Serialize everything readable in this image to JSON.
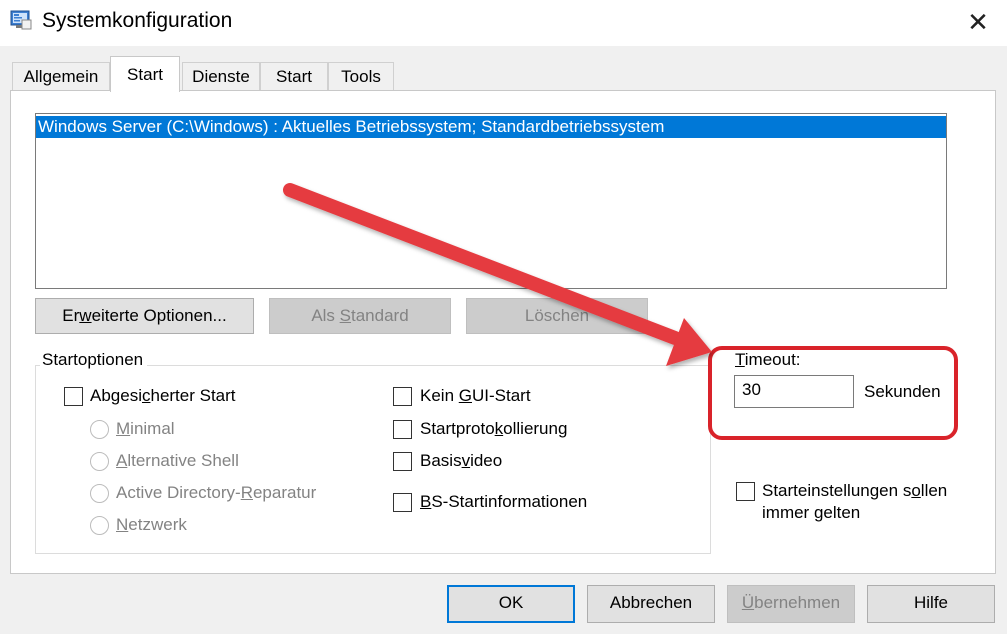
{
  "window": {
    "title": "Systemkonfiguration",
    "close_glyph": "✕"
  },
  "tabs": [
    {
      "label": "Allgemein"
    },
    {
      "label": "Start"
    },
    {
      "label": "Dienste"
    },
    {
      "label": "Start"
    },
    {
      "label": "Tools"
    }
  ],
  "boot_list": {
    "entries": [
      "Windows Server (C:\\Windows) : Aktuelles Betriebssystem; Standardbetriebssystem"
    ]
  },
  "boot_buttons": {
    "advanced": {
      "pre": "Er",
      "key": "w",
      "post": "eiterte Optionen..."
    },
    "set_default": {
      "pre": "Als ",
      "key": "S",
      "post": "tandard"
    },
    "delete": {
      "label": "Löschen"
    }
  },
  "startoptions": {
    "label": "Startoptionen",
    "safe_boot": {
      "pre": "Abgesi",
      "key": "c",
      "post": "herter Start"
    },
    "radios": {
      "minimal": {
        "key": "M",
        "post": "inimal"
      },
      "alt_shell": {
        "key": "A",
        "post": "lternative Shell"
      },
      "ad_repair": {
        "pre": "Active Directory-",
        "key": "R",
        "post": "eparatur"
      },
      "network": {
        "key": "N",
        "post": "etzwerk"
      }
    },
    "no_gui": {
      "pre": "Kein ",
      "key": "G",
      "post": "UI-Start"
    },
    "boot_log": {
      "pre": "Startproto",
      "key": "k",
      "post": "ollierung"
    },
    "base_video": {
      "pre": "Basis",
      "key": "v",
      "post": "ideo"
    },
    "os_info": {
      "key": "B",
      "post": "S-Startinformationen"
    }
  },
  "timeout": {
    "label_key": "T",
    "label_post": "imeout:",
    "value": "30",
    "unit": "Sekunden"
  },
  "permanent": {
    "line1_pre": "Starteinstellungen s",
    "line1_key": "o",
    "line1_post": "llen",
    "line2": "immer gelten"
  },
  "footer": {
    "ok": "OK",
    "cancel": "Abbrechen",
    "apply_key": "Ü",
    "apply_post": "bernehmen",
    "help": "Hilfe"
  },
  "colors": {
    "selection": "#0078d7",
    "annotation": "#d9232a",
    "arrow": "#e53a3f"
  },
  "icons": {
    "app": "msconfig-icon",
    "close": "close-icon"
  }
}
